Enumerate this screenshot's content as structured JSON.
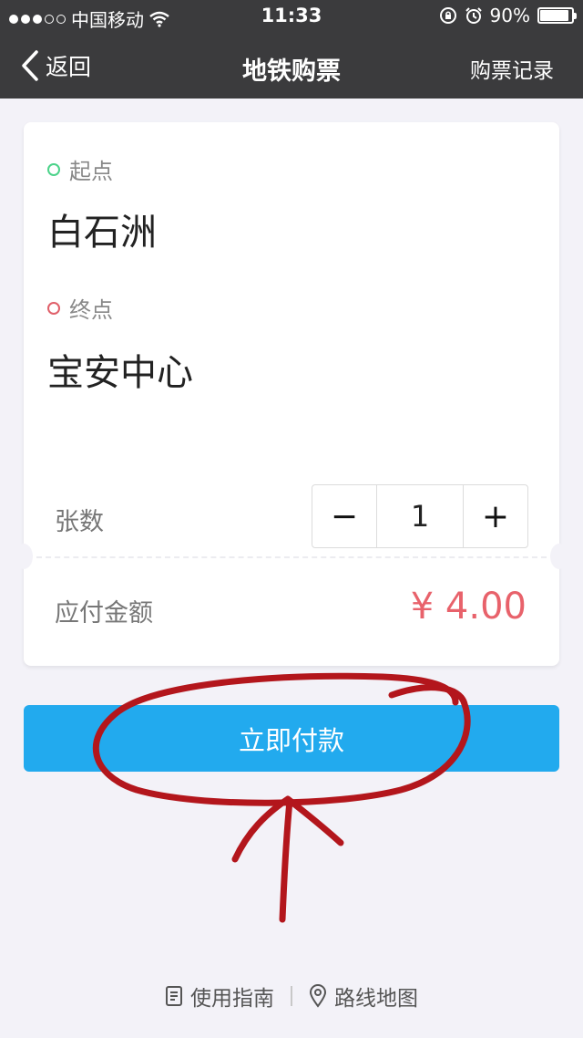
{
  "status_bar": {
    "carrier": "中国移动",
    "time": "11:33",
    "battery": "90%",
    "battery_level": 0.9
  },
  "nav": {
    "back_label": "返回",
    "title": "地铁购票",
    "right_label": "购票记录"
  },
  "ticket": {
    "origin_label": "起点",
    "origin": "白石洲",
    "destination_label": "终点",
    "destination": "宝安中心",
    "quantity_label": "张数",
    "quantity": "1",
    "decrement": "−",
    "increment": "+",
    "amount_label": "应付金额",
    "amount": "¥ 4.00"
  },
  "pay_button_label": "立即付款",
  "footer": {
    "guide": "使用指南",
    "route_map": "路线地图"
  },
  "colors": {
    "nav_bg": "#3b3b3d",
    "accent": "#22aaee",
    "price": "#e8626b",
    "origin_dot": "#4cd38a",
    "destination_dot": "#e0606a",
    "annotation": "#b3161c"
  }
}
